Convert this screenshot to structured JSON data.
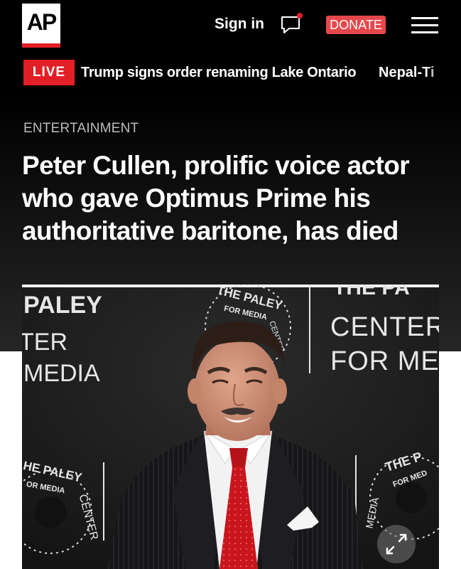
{
  "header": {
    "logo_text": "AP",
    "signin_label": "Sign in",
    "chat_icon": "chat-icon",
    "donate_label": "DONATE",
    "menu_icon": "hamburger-menu-icon"
  },
  "ticker": {
    "live_label": "LIVE",
    "items": [
      "Trump signs order renaming Lake Ontario",
      "Nepal-Ti"
    ]
  },
  "article": {
    "category": "ENTERTAINMENT",
    "headline_lines": [
      "Peter Cullen, prolific voice actor",
      "who gave Optimus Prime his",
      "authoritative baritone, has died"
    ]
  },
  "photo": {
    "backdrop_text": {
      "left_top": "PALEY",
      "left_mid": "TER",
      "left_bottom": "MEDIA",
      "right_top": "THE PA",
      "right_mid": "CENTER",
      "right_bottom": "FOR ME",
      "seal_top_arc": "THE PALEY",
      "seal_inner": "FOR MEDIA",
      "seal_small": "CENTER",
      "seal_bottom_left": "HE PALEY",
      "seal_bottom_left_inner": "OR MEDIA",
      "seal_bottom_left_side": "CENTER",
      "seal_bottom_right": "THE P",
      "seal_bottom_right_inner": "FOR MED",
      "seal_bottom_right_side": "MEDIA"
    },
    "expand_icon": "expand-arrows-icon"
  },
  "colors": {
    "brand_red": "#e21f26",
    "donate_red": "#e8484c",
    "background": "#000000"
  }
}
